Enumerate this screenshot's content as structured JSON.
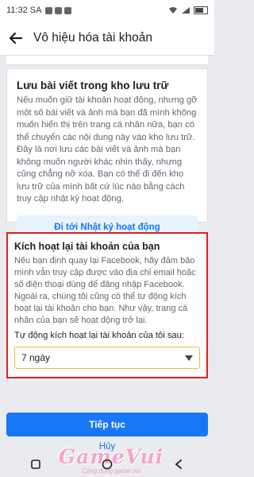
{
  "status_bar": {
    "time": "11:32 SA"
  },
  "app_bar": {
    "title": "Vô hiệu hóa tài khoản"
  },
  "archive_card": {
    "title": "Lưu bài viết trong kho lưu trữ",
    "body": "Nếu muốn giữ tài khoản hoạt động, nhưng gỡ một số bài viết và ảnh mà bạn đã mình không muốn hiển thị trên trang cá nhân nữa, bạn có thể chuyển các nội dung này vào kho lưu trữ. Đây là nơi lưu các bài viết và ảnh mà bạn không muốn người khác nhìn thấy, nhưng cũng chẳng nỡ xóa. Bạn có thể đi đến kho lưu trữ của mình bất cứ lúc nào bằng cách truy cập nhật ký hoạt động.",
    "button": "Đi tới Nhật ký hoạt động"
  },
  "reactivate_card": {
    "title": "Kích hoạt lại tài khoản của bạn",
    "body": "Nếu bạn định quay lại Facebook, hãy đảm bảo mình vẫn truy cập được vào địa chỉ email hoặc số điện thoại dùng để đăng nhập Facebook. Ngoài ra, chúng tôi cũng có thể tự động kích hoạt lại tài khoản cho bạn. Như vậy, trang cá nhân của bạn sẽ hoạt động trở lại.",
    "select_label": "Tự động kích hoạt lại tài khoản của tôi sau:",
    "select_value": "7 ngày"
  },
  "actions": {
    "continue": "Tiếp tục",
    "cancel": "Hủy"
  },
  "watermark": {
    "logo": "GameVui",
    "slogan": "Cộng đồng game vui"
  }
}
